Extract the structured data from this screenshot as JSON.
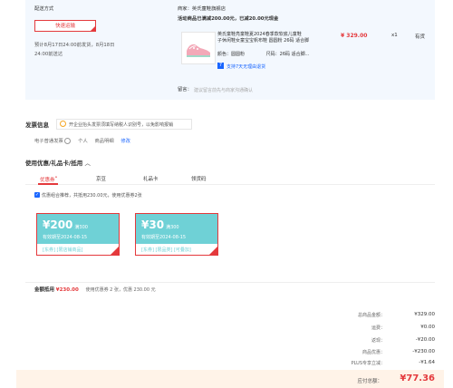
{
  "delivery": {
    "title": "配送方式",
    "express_btn": "快速运输",
    "estimate_line1": "预计8月17日24:00前发货，8月18日",
    "estimate_line2": "24:00前送达"
  },
  "shop": {
    "seller_label": "商家：",
    "seller_name": "英氏童鞋旗舰店",
    "promo": "活动商品已满减200.00元，已减20.00元现金",
    "product_title": "英氏童鞋亮童鞋夏2024春季款软底儿童鞋",
    "product_title2": "子休闲鞋女童宝宝帆布鞋 圆圆粉 26码 适合脚",
    "color_label": "颜色：",
    "color_value": "圆圆粉",
    "size_label": "尺码：",
    "size_value": "26码 适合脚...",
    "price": "¥ 329.00",
    "qty": "x1",
    "stock": "有货",
    "return_badge": "7",
    "return_note": "支持7天无理由退货",
    "remark_label": "留言：",
    "remark_placeholder": "建议留言前先与商家沟通确认"
  },
  "invoice": {
    "title": "发票信息",
    "tip_icon": "bulb-icon",
    "tip": "开企业抬头发票须填写纳税人识别号，以免影响报销",
    "type": "电子普通发票",
    "info_icon": "info-icon",
    "person": "个人",
    "detail": "商品明细",
    "edit": "修改"
  },
  "coupons": {
    "title": "使用优惠/礼品卡/抵用",
    "tabs": [
      "优惠券",
      "京豆",
      "礼品卡",
      "领货码"
    ],
    "tab_badge": "•",
    "combo_check": "✓",
    "combo_text": "优惠组合推荐，共抵用230.00元，使用优惠券2张",
    "list": [
      {
        "amount": "¥200",
        "cond": "满300",
        "date": "有效期至2024-08-15",
        "scope": "[东券] [限店铺商品]"
      },
      {
        "amount": "¥30",
        "cond": "满300",
        "date": "有效期至2024-08-15",
        "scope": "[东券] [限品类] [可叠加]"
      }
    ],
    "summary_label": "金额抵用",
    "summary_amount": "¥230.00",
    "summary_detail": "使用优惠券 2 张，优惠 230.00 元"
  },
  "totals": {
    "rows": [
      {
        "label": "总商品金额：",
        "value": "¥329.00"
      },
      {
        "label": "运费：",
        "value": "¥0.00"
      },
      {
        "label": "返现：",
        "value": "-¥20.00"
      },
      {
        "label": "商品优惠：",
        "value": "-¥230.00"
      },
      {
        "label": "PLUS专享立减：",
        "value": "-¥1.64"
      }
    ],
    "pay_label": "应付总额：",
    "pay_value": "¥77.36"
  },
  "colors": {
    "accent": "#e4393c",
    "link": "#1a66ff",
    "coupon": "#6fd1d6",
    "panel": "#f3f8fe"
  }
}
